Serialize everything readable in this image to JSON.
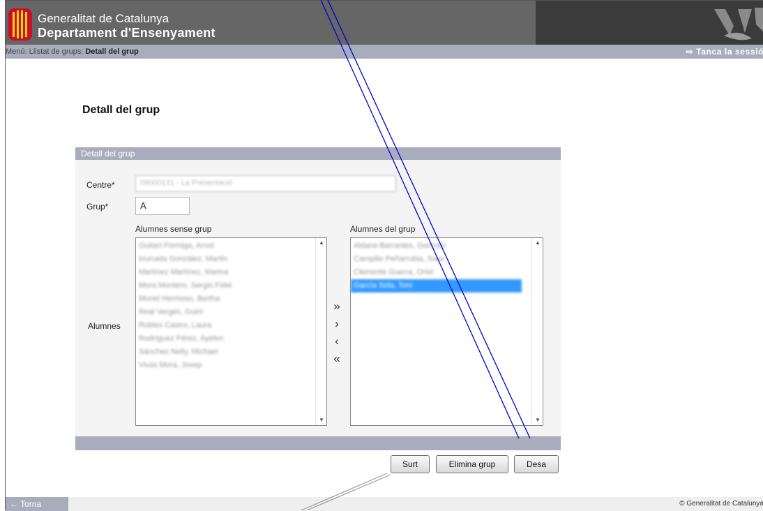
{
  "header": {
    "org_line1": "Generalitat de Catalunya",
    "org_line2": "Departament d'Ensenyament",
    "brand_color": "#666666",
    "logo_color": "#c8102e"
  },
  "menubar": {
    "menu": "Menú:",
    "crumb_list": "Llistat de grups:",
    "crumb_current": "Detall del grup",
    "logout": "Tanca la sessió"
  },
  "page": {
    "title": "Detall del grup"
  },
  "panel": {
    "header": "Detall del grup",
    "centre_label": "Centre*",
    "centre_value": "08000131 - La Presentació",
    "grup_label": "Grup*",
    "grup_value": "A",
    "alumnes_label": "Alumnes"
  },
  "lists": {
    "left_title": "Alumnes sense grup",
    "right_title": "Alumnes del grup",
    "left_items": [
      "Guitart Formiga, Arnol",
      "Inurueta González, Martín",
      "Martínez Martínez, Marina",
      "Mora Montero, Sergio Fidel",
      "Muriel Hermoso, Bertha",
      "Real Vergés, Guim",
      "Robles Castro, Laura",
      "Rodríguez Pérez, Ayelen",
      "Sánchez Nelly, Michael",
      "Vivas Mora, Josep"
    ],
    "right_items": [
      "Aldana Barrantes, Gonzalo",
      "Campillo Peñarrubia, Sara",
      "Clemente Guerra, Oriol",
      "García Sola, Toni"
    ],
    "selected_right_index": 3,
    "move_all_right": "»",
    "move_right": "›",
    "move_left": "‹",
    "move_all_left": "«"
  },
  "buttons": {
    "exit": "Surt",
    "delete": "Elimina grup",
    "save": "Desa"
  },
  "footer": {
    "back": "← Torna",
    "copyright": "© Generalitat de Catalunya"
  },
  "colors": {
    "bar": "#a9acbc",
    "selection": "#3399ff",
    "annotation": "#0000cc"
  }
}
